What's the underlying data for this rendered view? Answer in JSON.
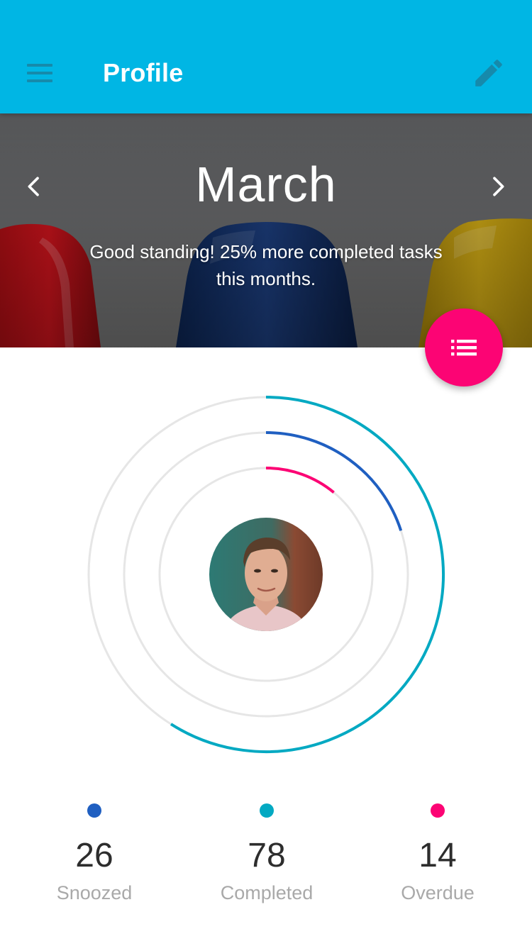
{
  "appbar": {
    "title": "Profile",
    "menu_icon": "menu-icon",
    "edit_icon": "pencil-icon",
    "background": "#00b6e4"
  },
  "hero": {
    "month": "March",
    "message": "Good standing! 25% more completed tasks this months.",
    "prev_icon": "chevron-left-icon",
    "next_icon": "chevron-right-icon"
  },
  "fab": {
    "icon": "list-icon",
    "color": "#fc0474"
  },
  "progress_rings": [
    {
      "name": "Completed",
      "fraction": 0.59,
      "color": "#03a9c2"
    },
    {
      "name": "Snoozed",
      "fraction": 0.2,
      "color": "#1f5fc1"
    },
    {
      "name": "Overdue",
      "fraction": 0.11,
      "color": "#fc0474"
    }
  ],
  "avatar": {
    "icon": "user-avatar"
  },
  "stats": [
    {
      "value": "26",
      "label": "Snoozed",
      "color": "#1f5fc1"
    },
    {
      "value": "78",
      "label": "Completed",
      "color": "#03a9c2"
    },
    {
      "value": "14",
      "label": "Overdue",
      "color": "#fc0474"
    }
  ]
}
